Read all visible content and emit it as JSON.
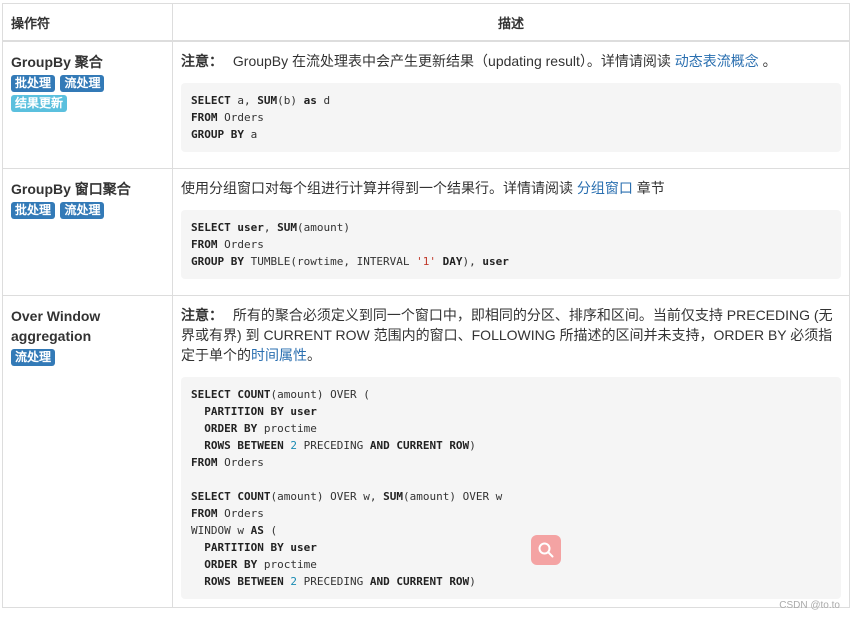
{
  "table": {
    "headers": {
      "operator": "操作符",
      "description": "描述"
    },
    "rows": [
      {
        "operator": "GroupBy 聚合",
        "labels": [
          "批处理",
          "流处理",
          "结果更新"
        ],
        "note_prefix": "注意：",
        "note_text": "GroupBy 在流处理表中会产生更新结果（updating result）。详情请阅读",
        "link": "动态表流概念",
        "note_suffix": "。",
        "code": {
          "l1_kw1": "SELECT",
          "l1_t1": " a, ",
          "l1_kw2": "SUM",
          "l1_t2": "(b) ",
          "l1_kw3": "as",
          "l1_t3": " d",
          "l2_kw1": "FROM",
          "l2_t1": " Orders",
          "l3_kw1": "GROUP BY",
          "l3_t1": " a"
        }
      },
      {
        "operator": "GroupBy 窗口聚合",
        "labels": [
          "批处理",
          "流处理"
        ],
        "desc_text": "使用分组窗口对每个组进行计算并得到一个结果行。详情请阅读",
        "link": "分组窗口",
        "desc_suffix": "章节",
        "code": {
          "l1_kw1": "SELECT",
          "l1_kw2": "user",
          "l1_t1": ", ",
          "l1_kw3": "SUM",
          "l1_t2": "(amount)",
          "l2_kw1": "FROM",
          "l2_t1": " Orders",
          "l3_kw1": "GROUP BY",
          "l3_t1": " TUMBLE(rowtime, INTERVAL ",
          "l3_str": "'1'",
          "l3_kw2": "DAY",
          "l3_t2": "), ",
          "l3_kw3": "user"
        }
      },
      {
        "operator": "Over Window aggregation",
        "labels": [
          "流处理"
        ],
        "note_prefix": "注意：",
        "note_text": "所有的聚合必须定义到同一个窗口中，即相同的分区、排序和区间。当前仅支持 PRECEDING (无界或有界) 到 CURRENT ROW 范围内的窗口、FOLLOWING 所描述的区间并未支持，ORDER BY 必须指定于单个的",
        "link": "时间属性",
        "note_suffix": "。",
        "code": {
          "a1_kw1": "SELECT",
          "a1_kw2": "COUNT",
          "a1_t1": "(amount) OVER (",
          "a2_kw1": "PARTITION",
          "a2_kw2": "BY",
          "a2_kw3": "user",
          "a3_kw1": "ORDER BY",
          "a3_t1": " proctime",
          "a4_kw1": "ROWS BETWEEN",
          "a4_num": "2",
          "a4_t1": " PRECEDING ",
          "a4_kw2": "AND CURRENT ROW",
          "a4_t2": ")",
          "a5_kw1": "FROM",
          "a5_t1": " Orders",
          "b1_kw1": "SELECT",
          "b1_kw2": "COUNT",
          "b1_t1": "(amount) OVER w, ",
          "b1_kw3": "SUM",
          "b1_t2": "(amount) OVER w",
          "b2_kw1": "FROM",
          "b2_t1": " Orders",
          "b3_t1": "WINDOW w ",
          "b3_kw1": "AS",
          "b3_t2": " (",
          "b4_kw1": "PARTITION",
          "b4_kw2": "BY",
          "b4_kw3": "user",
          "b5_kw1": "ORDER BY",
          "b5_t1": " proctime",
          "b6_kw1": "ROWS BETWEEN",
          "b6_num": "2",
          "b6_t1": " PRECEDING ",
          "b6_kw2": "AND CURRENT ROW",
          "b6_t2": ")"
        }
      }
    ]
  },
  "overlay": {
    "search_icon": "search-icon",
    "search_bg": "#f4a3a3"
  },
  "watermark": "CSDN @to.to",
  "colors": {
    "label_primary": "#337ab7",
    "label_info": "#5bc0de",
    "link": "#2a6fb0",
    "code_bg": "#f5f5f5"
  }
}
